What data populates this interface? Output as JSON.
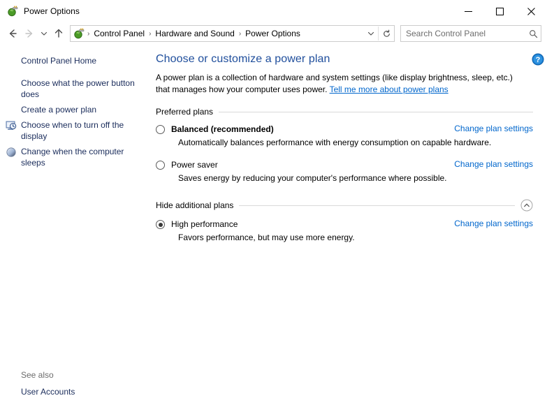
{
  "window": {
    "title": "Power Options",
    "icon": "power-plug-icon",
    "controls": {
      "minimize": "minimize-icon",
      "maximize": "maximize-icon",
      "close": "close-icon"
    }
  },
  "nav": {
    "back": "back-arrow-icon",
    "forward": "forward-arrow-icon",
    "recent": "chevron-down-icon",
    "up": "up-arrow-icon",
    "breadcrumb": [
      "Control Panel",
      "Hardware and Sound",
      "Power Options"
    ],
    "separator": "›",
    "dropdown": "chevron-down-icon",
    "refresh": "refresh-icon"
  },
  "search": {
    "placeholder": "Search Control Panel",
    "value": "",
    "icon": "search-icon"
  },
  "sidebar": {
    "items": [
      {
        "label": "Control Panel Home",
        "icon": null
      },
      {
        "label": "Choose what the power button does",
        "icon": null
      },
      {
        "label": "Create a power plan",
        "icon": null
      },
      {
        "label": "Choose when to turn off the display",
        "icon": "display-clock-icon"
      },
      {
        "label": "Change when the computer sleeps",
        "icon": "sleep-moon-icon"
      }
    ],
    "see_also_label": "See also",
    "see_also_items": [
      {
        "label": "User Accounts"
      }
    ]
  },
  "main": {
    "help_icon": "help-question-icon",
    "title": "Choose or customize a power plan",
    "description_part1": "A power plan is a collection of hardware and system settings (like display brightness, sleep, etc.) that manages how your computer uses power. ",
    "description_link": "Tell me more about power plans",
    "sections": [
      {
        "heading": "Preferred plans",
        "collapse_icon": null,
        "plans": [
          {
            "name": "Balanced (recommended)",
            "bold": true,
            "selected": false,
            "description": "Automatically balances performance with energy consumption on capable hardware.",
            "action": "Change plan settings"
          },
          {
            "name": "Power saver",
            "bold": false,
            "selected": false,
            "description": "Saves energy by reducing your computer's performance where possible.",
            "action": "Change plan settings"
          }
        ]
      },
      {
        "heading": "Hide additional plans",
        "collapse_icon": "chevron-up-circle-icon",
        "plans": [
          {
            "name": "High performance",
            "bold": false,
            "selected": true,
            "description": "Favors performance, but may use more energy.",
            "action": "Change plan settings"
          }
        ]
      }
    ]
  },
  "colors": {
    "link": "#0066cc",
    "title": "#1f4e9c",
    "sidebar_link": "#1a2c5b",
    "muted": "#6d6d6d",
    "rule": "#d9d9d9"
  }
}
